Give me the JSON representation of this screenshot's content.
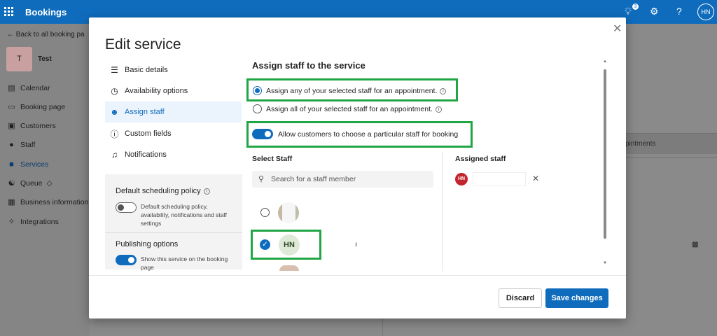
{
  "topbar": {
    "app_title": "Bookings",
    "lightbulb_badge": "3",
    "help": "?",
    "user_initials": "HN"
  },
  "nav": {
    "back_label": "Back to all booking pa",
    "business_initial": "T",
    "business_name": "Test",
    "items": [
      {
        "label": "Calendar",
        "icon": "calendar-icon"
      },
      {
        "label": "Booking page",
        "icon": "monitor-icon"
      },
      {
        "label": "Customers",
        "icon": "contact-card-icon"
      },
      {
        "label": "Staff",
        "icon": "people-icon"
      },
      {
        "label": "Services",
        "icon": "briefcase-icon"
      },
      {
        "label": "Queue",
        "icon": "queue-icon"
      },
      {
        "label": "Business information",
        "icon": "building-icon"
      },
      {
        "label": "Integrations",
        "icon": "integrations-icon"
      }
    ]
  },
  "background": {
    "column_text": "pintments"
  },
  "dialog": {
    "title": "Edit service",
    "menu": [
      {
        "label": "Basic details",
        "icon": "list-icon"
      },
      {
        "label": "Availability options",
        "icon": "clock-icon"
      },
      {
        "label": "Assign staff",
        "icon": "person-icon"
      },
      {
        "label": "Custom fields",
        "icon": "question-circle-icon"
      },
      {
        "label": "Notifications",
        "icon": "bell-icon"
      }
    ],
    "side_panel": {
      "default_policy_title": "Default scheduling policy",
      "default_policy_desc": "Default scheduling policy, availability, notifications and staff settings",
      "default_policy_on": false,
      "publishing_title": "Publishing options",
      "publishing_desc": "Show this service on the booking page",
      "publishing_on": true
    },
    "section_title": "Assign staff to the service",
    "options": {
      "assign_any": "Assign any of your selected staff for an appointment.",
      "assign_all": "Assign all of your selected staff for an appointment.",
      "allow_customers": "Allow customers to choose a particular staff for booking",
      "selected": "assign_any",
      "allow_customers_on": true
    },
    "select_staff_label": "Select Staff",
    "search_placeholder": "Search for a staff member",
    "staff": [
      {
        "initials": "",
        "selected": false
      },
      {
        "initials": "HN",
        "selected": true,
        "name_fragment": "ı"
      }
    ],
    "assigned_label": "Assigned staff",
    "assigned": [
      {
        "initials": "HN"
      }
    ],
    "buttons": {
      "discard": "Discard",
      "save": "Save changes"
    },
    "colors": {
      "accent": "#0f6cbd",
      "highlight": "#21a645"
    }
  }
}
